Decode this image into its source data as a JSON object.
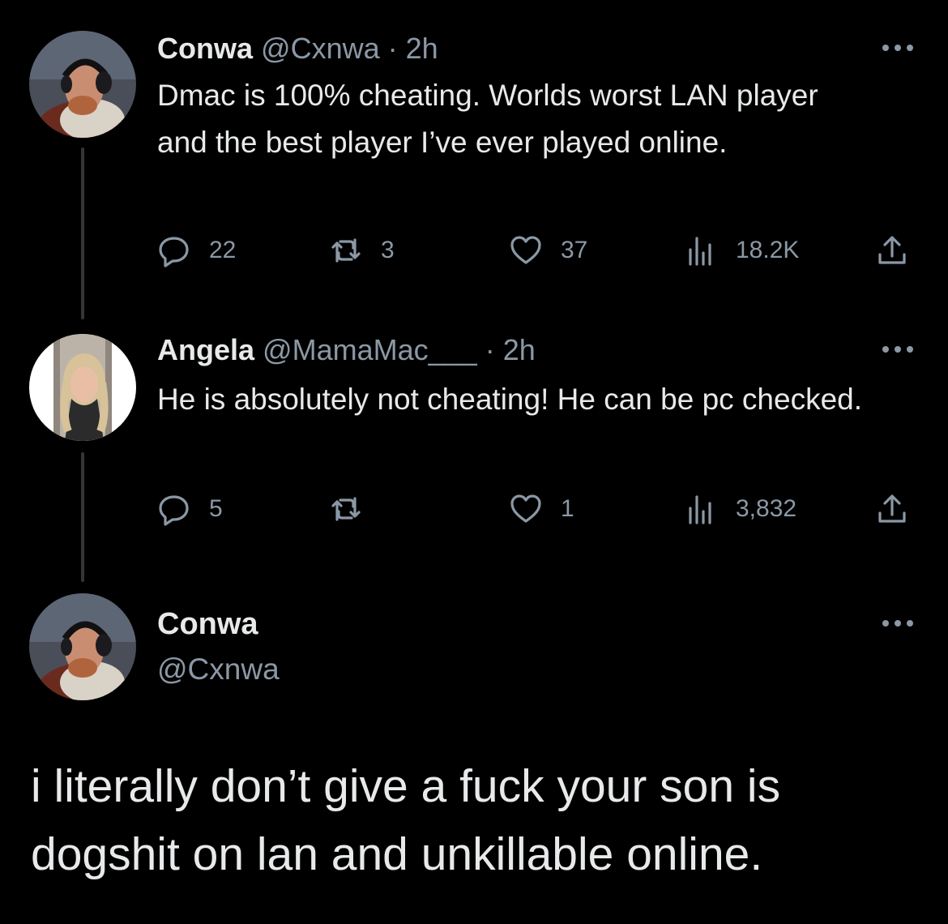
{
  "colors": {
    "background": "#000000",
    "text": "#e7e9ea",
    "secondary": "#8b98a5",
    "thread_line": "#333639"
  },
  "tweets": [
    {
      "name": "Conwa",
      "handle": "@Cxnwa",
      "dot": "·",
      "time": "2h",
      "text": "Dmac is 100% cheating. Worlds worst LAN player and the best player I’ve ever played online.",
      "replies": "22",
      "retweets": "3",
      "likes": "37",
      "views": "18.2K"
    },
    {
      "name": "Angela",
      "handle": "@MamaMac___",
      "dot": "·",
      "time": "2h",
      "text": "He is absolutely not cheating! He can be pc checked.",
      "replies": "5",
      "retweets": "",
      "likes": "1",
      "views": "3,832"
    }
  ],
  "main_tweet": {
    "name": "Conwa",
    "handle": "@Cxnwa",
    "text": "i literally don’t give a fuck your son is dogshit on lan and unkillable online."
  },
  "icons": {
    "reply": "reply-icon",
    "retweet": "retweet-icon",
    "like": "heart-icon",
    "views": "views-icon",
    "share": "share-icon",
    "more": "more-icon"
  }
}
